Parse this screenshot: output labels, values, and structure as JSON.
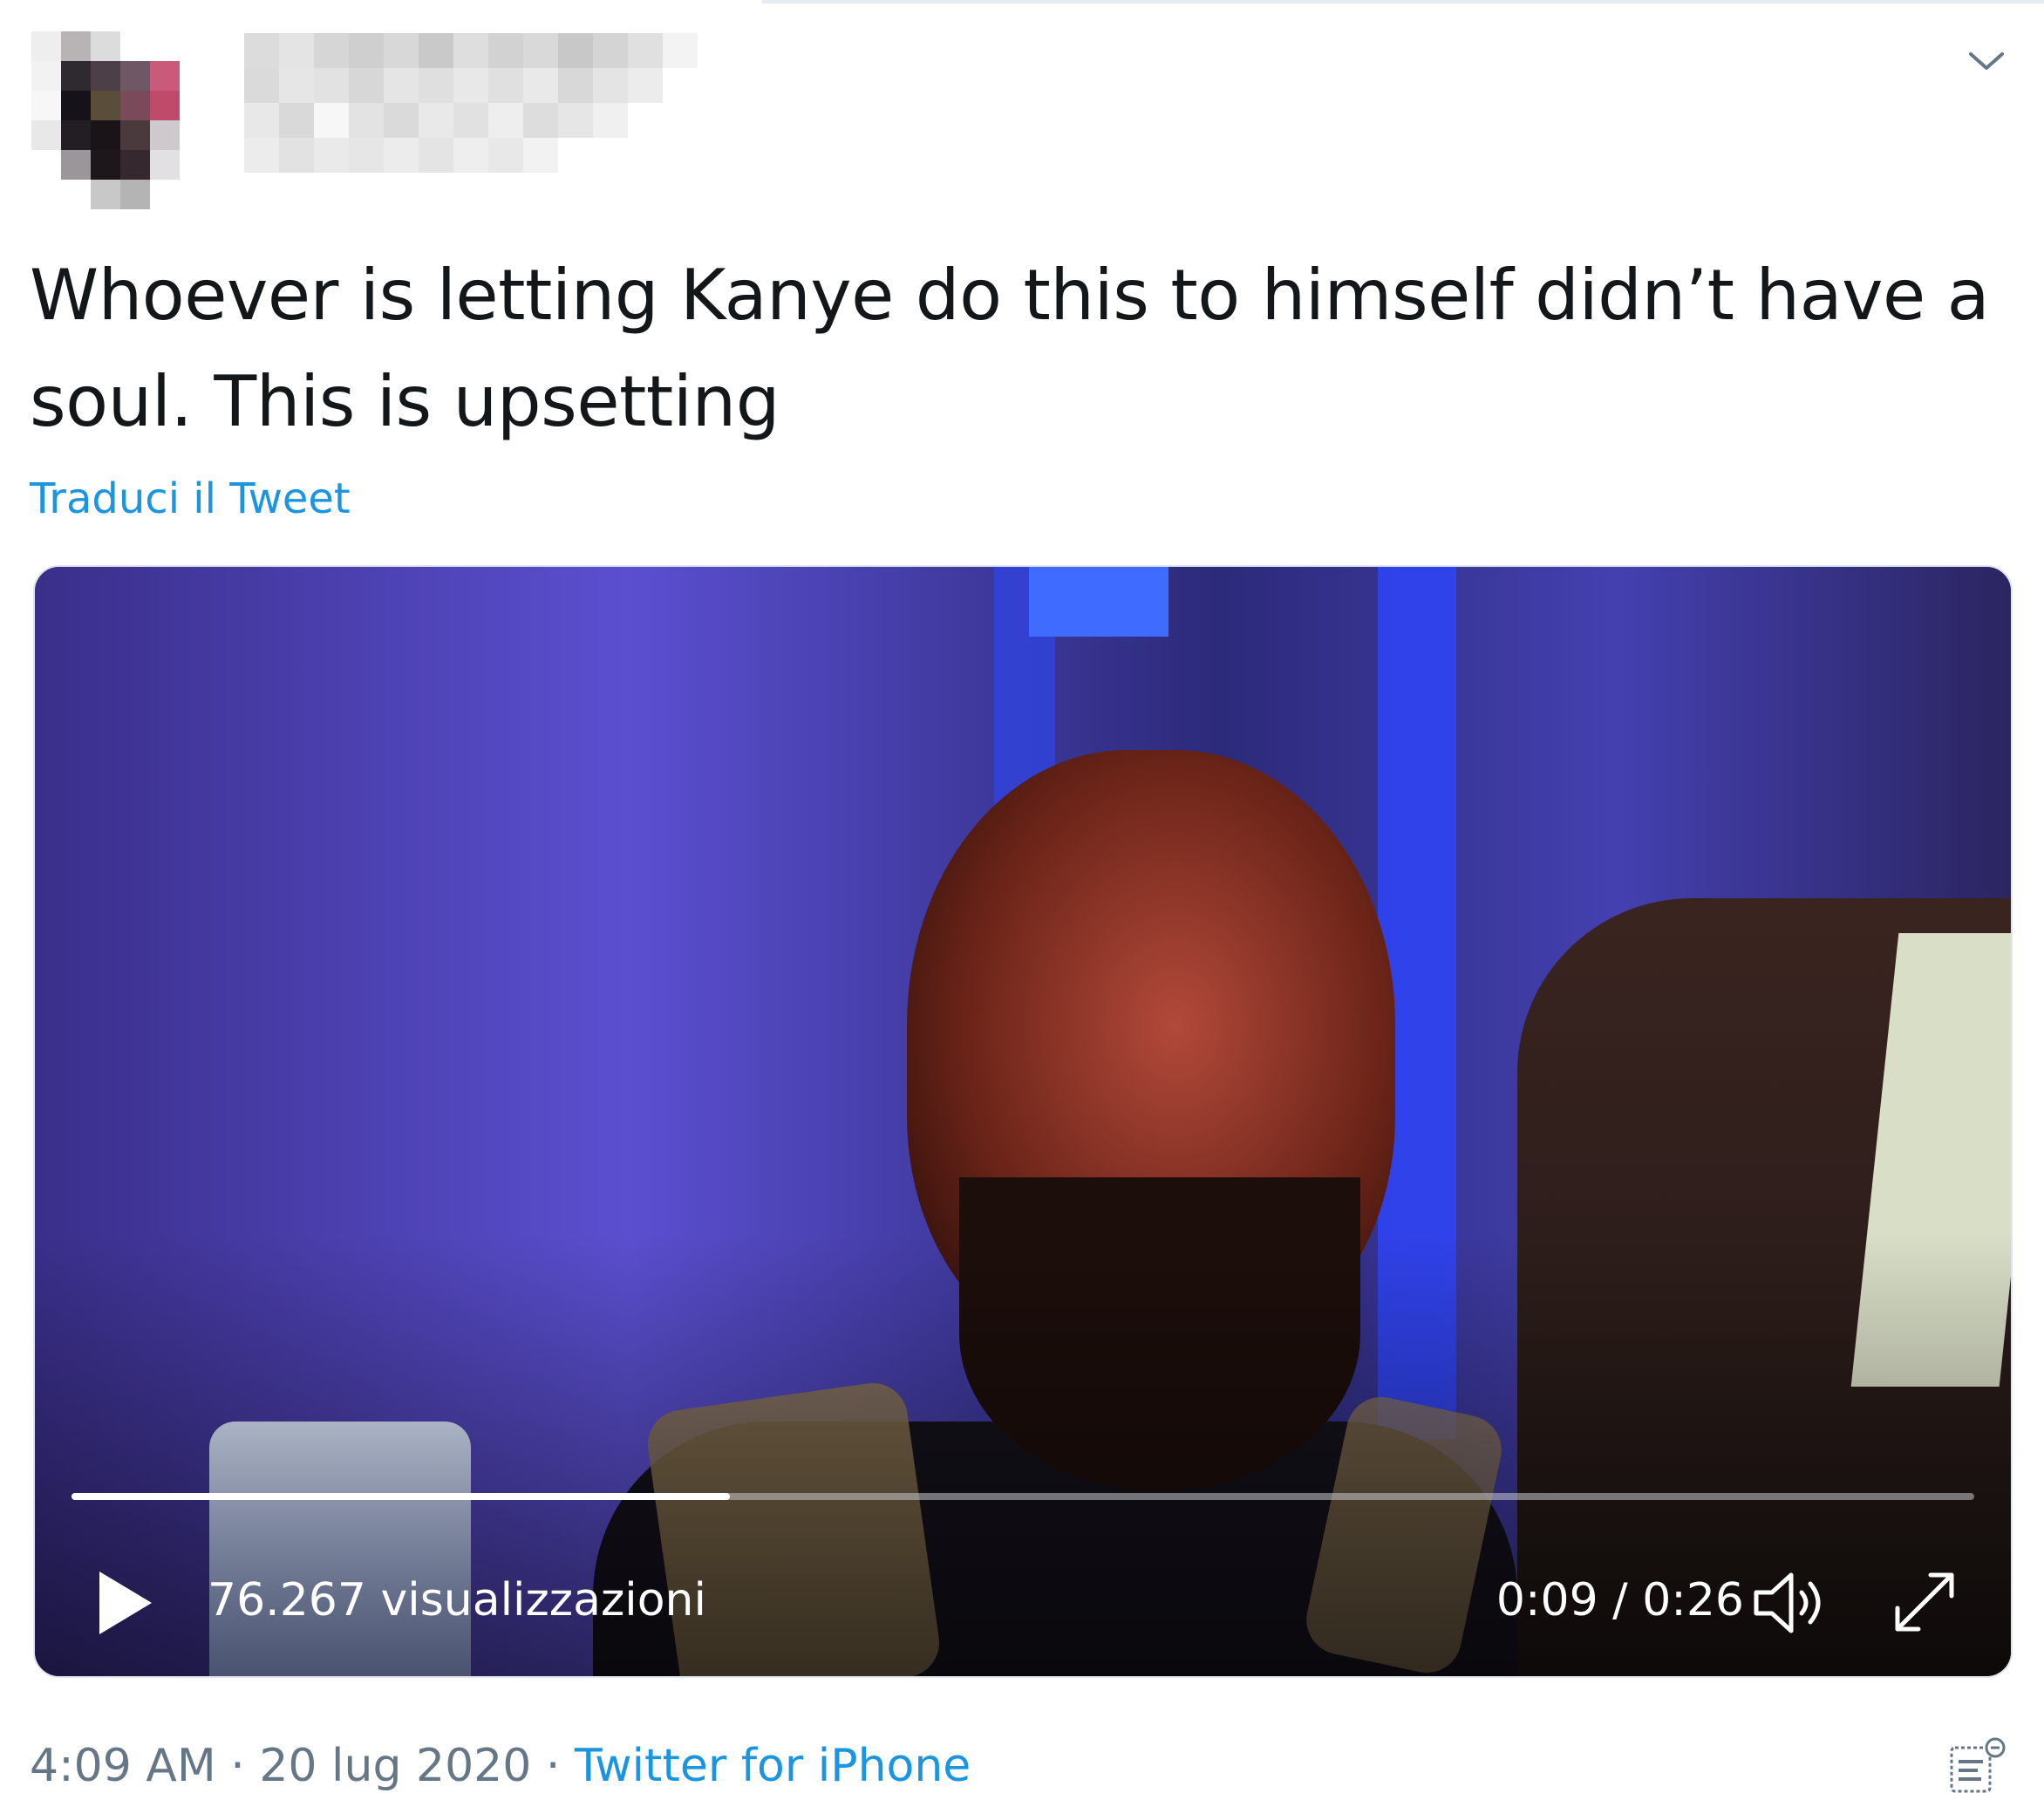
{
  "tweet": {
    "text": "Whoever is letting Kanye do this to himself didn’t have a soul. This is upsetting",
    "translate_label": "Traduci il Tweet"
  },
  "video": {
    "views_label": "76.267 visualizzazioni",
    "time_label": "0:09 / 0:26",
    "progress_fraction": 0.346,
    "play_icon": "play-icon",
    "volume_icon": "volume-icon",
    "fullscreen_icon": "fullscreen-icon"
  },
  "meta": {
    "time": "4:09 AM",
    "separator": "·",
    "date": "20 lug 2020",
    "source": "Twitter for iPhone"
  },
  "colors": {
    "link": "#1b95e0",
    "meta_text": "#657786",
    "tweet_text": "#14171a"
  }
}
